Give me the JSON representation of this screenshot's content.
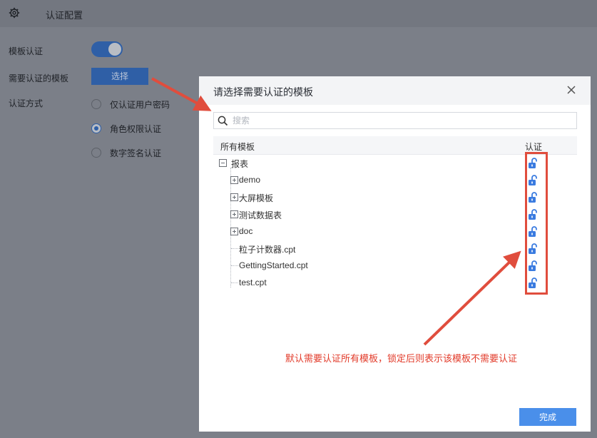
{
  "page": {
    "header_title": "认证配置",
    "template_auth_label": "模板认证",
    "template_auth_enabled": true,
    "needs_auth_label": "需要认证的模板",
    "select_button": "选择",
    "auth_method_label": "认证方式",
    "auth_methods": [
      {
        "label": "仅认证用户密码",
        "selected": false
      },
      {
        "label": "角色权限认证",
        "selected": true
      },
      {
        "label": "数字签名认证",
        "selected": false
      }
    ]
  },
  "dialog": {
    "title": "请选择需要认证的模板",
    "search_placeholder": "搜索",
    "col_all_templates": "所有模板",
    "col_auth": "认证",
    "tree": [
      {
        "label": "报表",
        "expander": "minus",
        "lock": "unlocked"
      },
      {
        "label": "demo",
        "expander": "plus",
        "lock": "unlocked"
      },
      {
        "label": "大屏模板",
        "expander": "plus",
        "lock": "unlocked"
      },
      {
        "label": "测试数据表",
        "expander": "plus",
        "lock": "unlocked"
      },
      {
        "label": "doc",
        "expander": "plus",
        "lock": "unlocked"
      },
      {
        "label": "粒子计数器.cpt",
        "expander": "none",
        "lock": "unlocked"
      },
      {
        "label": "GettingStarted.cpt",
        "expander": "none",
        "lock": "unlocked"
      },
      {
        "label": "test.cpt",
        "expander": "none",
        "lock": "unlocked"
      }
    ],
    "done_button": "完成"
  },
  "annotation": {
    "note": "默认需要认证所有模板，锁定后则表示该模板不需要认证",
    "color": "#e23b2a"
  },
  "colors": {
    "accent": "#2f5fa6",
    "done_button": "#4a8fea",
    "lock_icon": "#3a7be0",
    "annotation": "#e04d3d"
  }
}
